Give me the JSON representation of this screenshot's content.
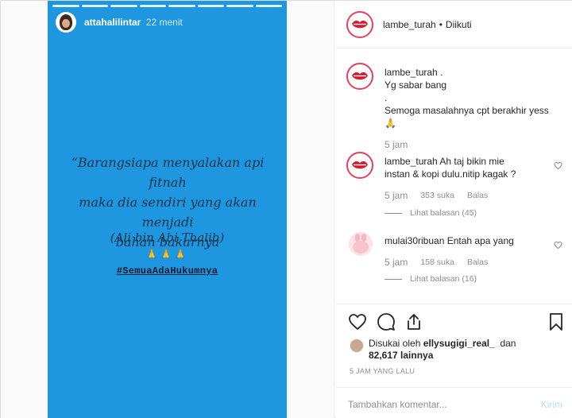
{
  "story": {
    "username": "attahalilintar",
    "time": "22 menit",
    "quote_line1": "“Barangsiapa menyalakan api fitnah",
    "quote_line2": "maka dia sendiri yang akan menjadi",
    "quote_line3": "bahan bakarnya",
    "author": "(Ali bin Abi Thalib)",
    "emoji": "🙏🙏🙏",
    "hashtag": "#SemuaAdaHukumnya",
    "progress_segments": 8,
    "background_color": "#1e97e0"
  },
  "post_header": {
    "username": "lambe_turah",
    "separator": "•",
    "follow_status": "Diikuti"
  },
  "caption": {
    "username": "lambe_turah",
    "punct": ".",
    "line1": "Yg sabar bang",
    "line2": ".",
    "line3": "Semoga masalahnya cpt berakhir yess",
    "emoji": "🙏",
    "time": "5 jam"
  },
  "comments": [
    {
      "username": "lambe_turah",
      "text": "Ah taj bikin mie instan & kopi dulu.nitip kagak ?",
      "time": "5 jam",
      "likes": "353 suka",
      "reply": "Balas",
      "view_replies": "Lihat balasan (45)"
    },
    {
      "username": "mulai30ribuan",
      "text": "Entah apa yang",
      "time": "5 jam",
      "likes": "158 suka",
      "reply": "Balas",
      "view_replies": "Lihat balasan (16)"
    }
  ],
  "likes": {
    "prefix": "Disukai oleh",
    "user": "ellysugigi_real_",
    "joiner": "dan",
    "count": "82,617",
    "suffix": "lainnya"
  },
  "post_time": "5 JAM YANG LALU",
  "add_comment": {
    "placeholder": "Tambahkan komentar...",
    "post_label": "Kirim"
  },
  "colors": {
    "accent_red": "#e4405f",
    "text": "#262626",
    "muted": "#8e8e8e",
    "post_button": "#b2dffc"
  },
  "icons": [
    "heart-icon",
    "comment-icon",
    "share-icon",
    "bookmark-icon"
  ]
}
